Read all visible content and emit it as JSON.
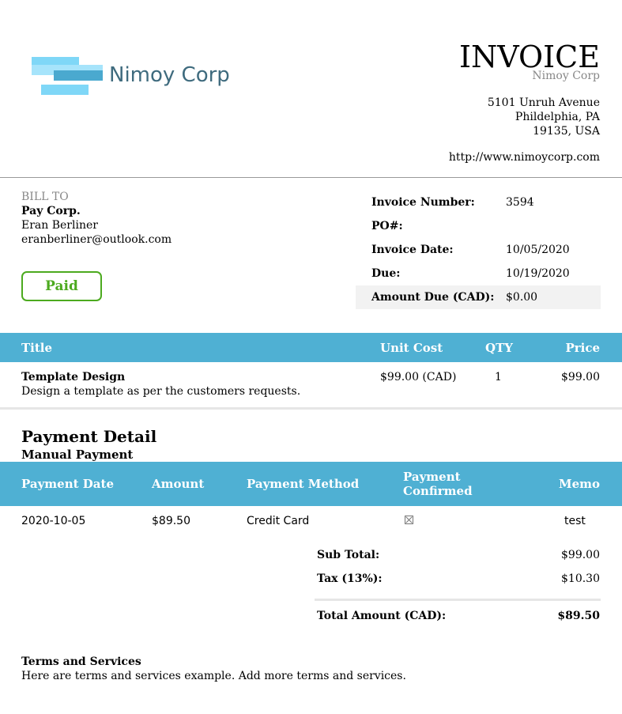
{
  "company": {
    "logo_text": "Nimoy Corp",
    "name": "Nimoy Corp",
    "address_line1": "5101 Unruh Avenue",
    "address_line2": "Phildelphia, PA",
    "address_line3": "19135, USA",
    "website": "http://www.nimoycorp.com"
  },
  "header": {
    "title": "INVOICE"
  },
  "bill_to": {
    "label": "BILL TO",
    "company": "Pay Corp.",
    "name": "Eran Berliner",
    "email": "eranberliner@outlook.com"
  },
  "status": {
    "label": "Paid",
    "color": "#4caa1f"
  },
  "meta": [
    {
      "label": "Invoice Number:",
      "value": "3594"
    },
    {
      "label": "PO#:",
      "value": ""
    },
    {
      "label": "Invoice Date:",
      "value": "10/05/2020"
    },
    {
      "label": "Due:",
      "value": "10/19/2020"
    },
    {
      "label": "Amount Due (CAD):",
      "value": "$0.00"
    }
  ],
  "items": {
    "headers": {
      "title": "Title",
      "unit_cost": "Unit Cost",
      "qty": "QTY",
      "price": "Price"
    },
    "rows": [
      {
        "title": "Template Design",
        "description": "Design a template as per the customers requests.",
        "unit_cost": "$99.00 (CAD)",
        "qty": "1",
        "price": "$99.00"
      }
    ]
  },
  "payment": {
    "heading": "Payment Detail",
    "subheading": "Manual Payment",
    "headers": {
      "date": "Payment Date",
      "amount": "Amount",
      "method": "Payment Method",
      "confirmed_1": "Payment",
      "confirmed_2": "Confirmed",
      "memo": "Memo"
    },
    "rows": [
      {
        "date": "2020-10-05",
        "amount": "$89.50",
        "method": "Credit Card",
        "confirmed_icon": "checkbox-crossed-icon",
        "memo": "test"
      }
    ]
  },
  "totals": {
    "subtotal_label": "Sub Total:",
    "subtotal": "$99.00",
    "tax_label": "Tax (13%):",
    "tax": "$10.30",
    "total_label": "Total Amount (CAD):",
    "total": "$89.50"
  },
  "terms": {
    "heading": "Terms and Services",
    "text": "Here are terms and services example. Add more terms and services."
  },
  "colors": {
    "accent": "#4fb0d3",
    "logo_light": "#7fd7f7",
    "logo_dark": "#4aa9cf"
  }
}
